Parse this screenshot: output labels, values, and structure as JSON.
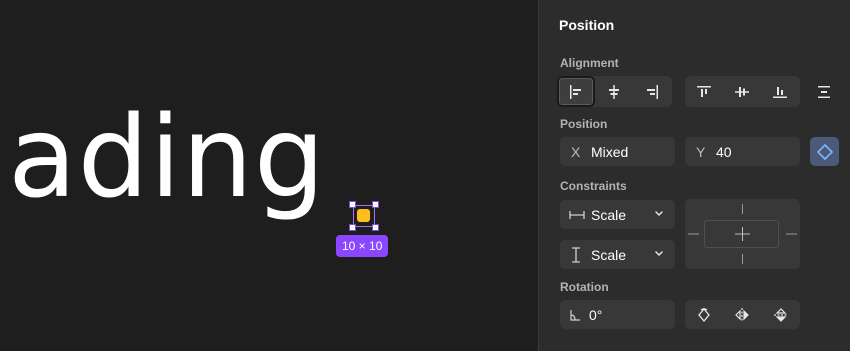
{
  "canvas": {
    "text": "ading",
    "size_badge": "10 × 10",
    "colors": {
      "selection": "#a371f7",
      "badge": "#8b46ff",
      "layer_fill": "#ffbd1f"
    }
  },
  "panel": {
    "title": "Position",
    "alignment_label": "Alignment",
    "alignment_buttons": [
      {
        "icon": "align-left-icon",
        "active": true
      },
      {
        "icon": "align-horizontal-center-icon",
        "active": false
      },
      {
        "icon": "align-right-icon",
        "active": false
      },
      {
        "icon": "align-top-icon",
        "active": false
      },
      {
        "icon": "align-vertical-center-icon",
        "active": false
      },
      {
        "icon": "align-bottom-icon",
        "active": false
      },
      {
        "icon": "distribute-spacing-icon",
        "active": false
      }
    ],
    "position_label": "Position",
    "x": {
      "label": "X",
      "value": "Mixed"
    },
    "y": {
      "label": "Y",
      "value": "40"
    },
    "constraints_label": "Constraints",
    "horizontal_constraint": {
      "value": "Scale",
      "icon": "horizontal-constraint-icon"
    },
    "vertical_constraint": {
      "value": "Scale",
      "icon": "vertical-constraint-icon"
    },
    "rotation_label": "Rotation",
    "rotation": {
      "value": "0°",
      "icon": "angle-icon"
    },
    "rotation_buttons": [
      {
        "icon": "rotate-icon"
      },
      {
        "icon": "flip-horizontal-icon"
      },
      {
        "icon": "flip-vertical-icon"
      }
    ],
    "colors": {
      "panel_bg": "#2c2c2c",
      "field_bg": "#383838",
      "move_button_bg": "#4a5a78",
      "move_icon": "#7fb7ff"
    }
  }
}
